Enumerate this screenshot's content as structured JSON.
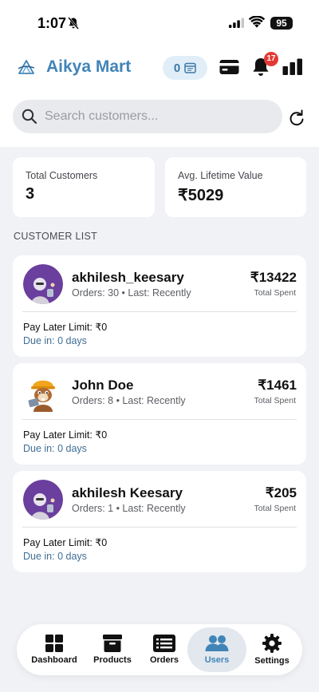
{
  "status_bar": {
    "time": "1:07",
    "battery": "95"
  },
  "header": {
    "title": "Aikya Mart",
    "cart_count": "0",
    "notification_count": "17"
  },
  "search": {
    "placeholder": "Search customers..."
  },
  "summary": {
    "total_customers_label": "Total Customers",
    "total_customers_value": "3",
    "avg_ltv_label": "Avg. Lifetime Value",
    "avg_ltv_value": "₹5029"
  },
  "section_title": "CUSTOMER LIST",
  "customers": [
    {
      "name": "akhilesh_keesary",
      "meta": "Orders: 30 • Last: Recently",
      "amount": "₹13422",
      "amount_label": "Total Spent",
      "limit": "Pay Later Limit: ₹0",
      "due": "Due in: 0 days"
    },
    {
      "name": "John Doe",
      "meta": "Orders: 8 • Last: Recently",
      "amount": "₹1461",
      "amount_label": "Total Spent",
      "limit": "Pay Later Limit: ₹0",
      "due": "Due in: 0 days"
    },
    {
      "name": "akhilesh Keesary",
      "meta": "Orders: 1 • Last: Recently",
      "amount": "₹205",
      "amount_label": "Total Spent",
      "limit": "Pay Later Limit: ₹0",
      "due": "Due in: 0 days"
    }
  ],
  "tabs": [
    {
      "label": "Dashboard",
      "icon": "grid-icon"
    },
    {
      "label": "Products",
      "icon": "archive-box-icon"
    },
    {
      "label": "Orders",
      "icon": "list-icon"
    },
    {
      "label": "Users",
      "icon": "users-icon",
      "active": true
    },
    {
      "label": "Settings",
      "icon": "gear-icon"
    }
  ],
  "colors": {
    "brand": "#4184b8",
    "badge": "#e53935",
    "due_text": "#3f6e95",
    "avatar_purple": "#6a3f9e"
  }
}
